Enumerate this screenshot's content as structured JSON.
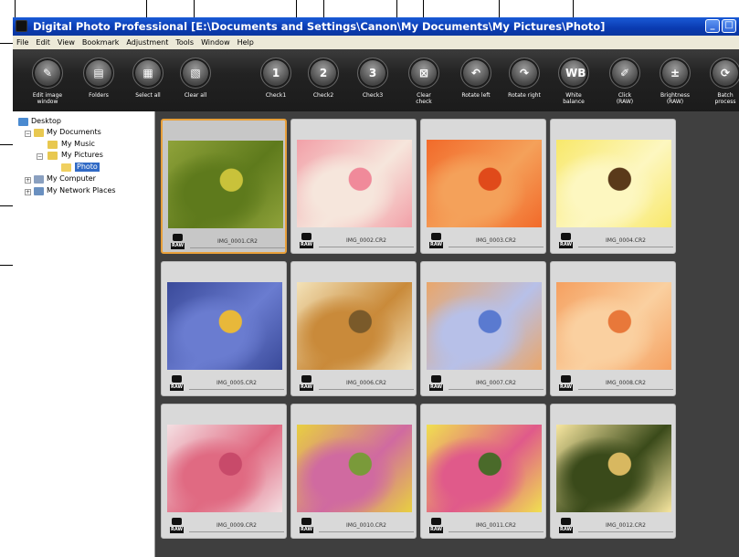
{
  "window": {
    "title": "Digital Photo Professional   [E:\\Documents and Settings\\Canon\\My Documents\\My Pictures\\Photo]",
    "minimize_glyph": "_",
    "maximize_glyph": "□"
  },
  "menu": [
    "File",
    "Edit",
    "View",
    "Bookmark",
    "Adjustment",
    "Tools",
    "Window",
    "Help"
  ],
  "toolbar": [
    {
      "label": "Edit image\nwindow",
      "icon": "edit-image-icon",
      "glyph": "✎"
    },
    {
      "label": "Folders",
      "icon": "folders-icon",
      "glyph": "▤"
    },
    {
      "label": "Select all",
      "icon": "select-all-icon",
      "glyph": "▦"
    },
    {
      "label": "Clear all",
      "icon": "clear-all-icon",
      "glyph": "▧"
    },
    {
      "label": "Check1",
      "icon": "check1-icon",
      "glyph": "1"
    },
    {
      "label": "Check2",
      "icon": "check2-icon",
      "glyph": "2"
    },
    {
      "label": "Check3",
      "icon": "check3-icon",
      "glyph": "3"
    },
    {
      "label": "Clear\ncheck",
      "icon": "clear-check-icon",
      "glyph": "⊠"
    },
    {
      "label": "Rotate left",
      "icon": "rotate-left-icon",
      "glyph": "↶"
    },
    {
      "label": "Rotate right",
      "icon": "rotate-right-icon",
      "glyph": "↷"
    },
    {
      "label": "White\nbalance",
      "icon": "white-balance-icon",
      "glyph": "WB"
    },
    {
      "label": "Click\n(RAW)",
      "icon": "eyedropper-icon",
      "glyph": "✐"
    },
    {
      "label": "Brightness\n(RAW)",
      "icon": "brightness-icon",
      "glyph": "±"
    },
    {
      "label": "Batch\nprocess",
      "icon": "batch-process-icon",
      "glyph": "⟳"
    }
  ],
  "tree": {
    "desktop": "Desktop",
    "my_documents": "My Documents",
    "my_music": "My Music",
    "my_pictures": "My Pictures",
    "photo": "Photo",
    "my_computer": "My Computer",
    "my_network": "My Network Places"
  },
  "thumbnails": [
    {
      "filename": "IMG_0001.CR2",
      "badge": "RAW",
      "colors": [
        "#8fa23a",
        "#5e7a1c",
        "#c9c23a"
      ]
    },
    {
      "filename": "IMG_0002.CR2",
      "badge": "RAW",
      "colors": [
        "#f2a0a8",
        "#f6e6dc",
        "#f08a9a"
      ]
    },
    {
      "filename": "IMG_0003.CR2",
      "badge": "RAW",
      "colors": [
        "#f26a2a",
        "#f4a15a",
        "#e04a1a"
      ]
    },
    {
      "filename": "IMG_0004.CR2",
      "badge": "RAW",
      "colors": [
        "#f8e86a",
        "#fdf7c0",
        "#5a3a1a"
      ]
    },
    {
      "filename": "IMG_0005.CR2",
      "badge": "RAW",
      "colors": [
        "#3a4a9a",
        "#6a7cd0",
        "#e8b83a"
      ]
    },
    {
      "filename": "IMG_0006.CR2",
      "badge": "RAW",
      "colors": [
        "#f3e2b8",
        "#c98a3a",
        "#7a5a2a"
      ]
    },
    {
      "filename": "IMG_0007.CR2",
      "badge": "RAW",
      "colors": [
        "#e9a66a",
        "#b7c0e8",
        "#5a7ad0"
      ]
    },
    {
      "filename": "IMG_0008.CR2",
      "badge": "RAW",
      "colors": [
        "#f5a060",
        "#fad0a0",
        "#e8783a"
      ]
    },
    {
      "filename": "IMG_0009.CR2",
      "badge": "RAW",
      "colors": [
        "#f4dfe2",
        "#e06a82",
        "#c84a6a"
      ]
    },
    {
      "filename": "IMG_0010.CR2",
      "badge": "RAW",
      "colors": [
        "#e8d040",
        "#d06aa0",
        "#7a9a3a"
      ]
    },
    {
      "filename": "IMG_0011.CR2",
      "badge": "RAW",
      "colors": [
        "#f0e050",
        "#e05a8a",
        "#4a6a2a"
      ]
    },
    {
      "filename": "IMG_0012.CR2",
      "badge": "RAW",
      "colors": [
        "#f7e6a0",
        "#3a4a1a",
        "#d8b860"
      ]
    }
  ],
  "colors": {
    "title_blue": "#0a3ab0",
    "toolbar_dark": "#1b1b1b",
    "grid_background": "#3f3f3f",
    "selection_border": "#e8a03a"
  }
}
